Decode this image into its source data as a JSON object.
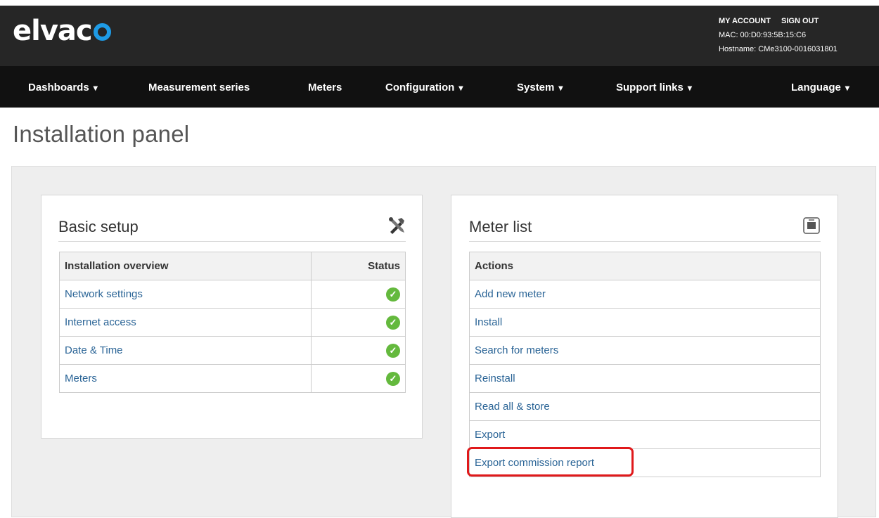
{
  "header": {
    "logo_text": "elvac",
    "account_links": [
      "MY ACCOUNT",
      "SIGN OUT"
    ],
    "mac": "MAC: 00:D0:93:5B:15:C6",
    "hostname": "Hostname: CMe3100-0016031801"
  },
  "nav": {
    "items": [
      {
        "label": "Dashboards",
        "caret": "▾"
      },
      {
        "label": "Measurement series"
      },
      {
        "label": "Meters"
      },
      {
        "label": "Configuration",
        "caret": "▾"
      },
      {
        "label": "System",
        "caret": "▾"
      },
      {
        "label": "Support links",
        "caret": "▾"
      },
      {
        "label": "Language",
        "caret": "▾"
      }
    ]
  },
  "page": {
    "title": "Installation panel"
  },
  "basic_setup": {
    "title": "Basic setup",
    "icon": "tools-icon",
    "columns": [
      "Installation overview",
      "Status"
    ],
    "rows": [
      {
        "label": "Network settings",
        "status": "ok"
      },
      {
        "label": "Internet access",
        "status": "ok"
      },
      {
        "label": "Date & Time",
        "status": "ok"
      },
      {
        "label": "Meters",
        "status": "ok"
      }
    ],
    "status_color": "#64b93d"
  },
  "meter_list": {
    "title": "Meter list",
    "icon": "meter-icon",
    "header": "Actions",
    "actions": [
      "Add new meter",
      "Install",
      "Search for meters",
      "Reinstall",
      "Read all & store",
      "Export",
      "Export commission report"
    ]
  },
  "colors": {
    "header_bg": "#262626",
    "nav_bg": "#111111",
    "link": "#2a6496",
    "accent": "#1e9be6",
    "highlight": "#e0191b"
  }
}
